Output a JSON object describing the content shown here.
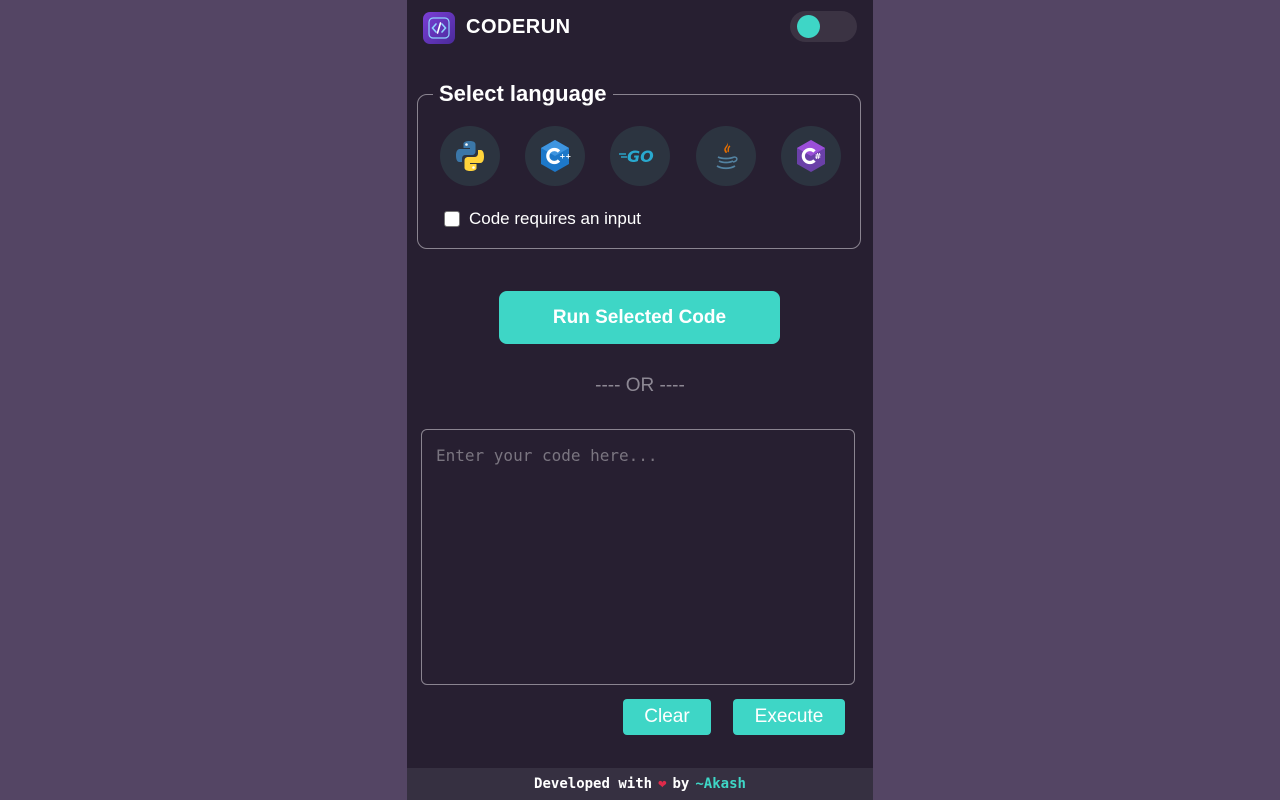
{
  "header": {
    "brand": "CODERUN",
    "logo_icon": "code-brackets-icon",
    "theme_toggle": {
      "state": "off",
      "icon": "toggle-icon"
    }
  },
  "language_section": {
    "legend": "Select language",
    "languages": [
      {
        "name": "Python",
        "icon": "python-icon"
      },
      {
        "name": "C++",
        "icon": "cpp-icon"
      },
      {
        "name": "Go",
        "icon": "go-icon"
      },
      {
        "name": "Java",
        "icon": "java-icon"
      },
      {
        "name": "C#",
        "icon": "csharp-icon"
      }
    ],
    "input_checkbox_label": "Code requires an input",
    "input_checkbox_checked": false
  },
  "run_button": "Run Selected Code",
  "separator": "---- OR ----",
  "editor": {
    "placeholder": "Enter your code here...",
    "value": ""
  },
  "actions": {
    "clear": "Clear",
    "execute": "Execute"
  },
  "footer": {
    "prefix": "Developed with",
    "heart_icon": "heart-icon",
    "by": "by",
    "author": "~Akash"
  },
  "colors": {
    "accent": "#3ed6c6",
    "background": "#544564",
    "panel": "#271f31"
  }
}
